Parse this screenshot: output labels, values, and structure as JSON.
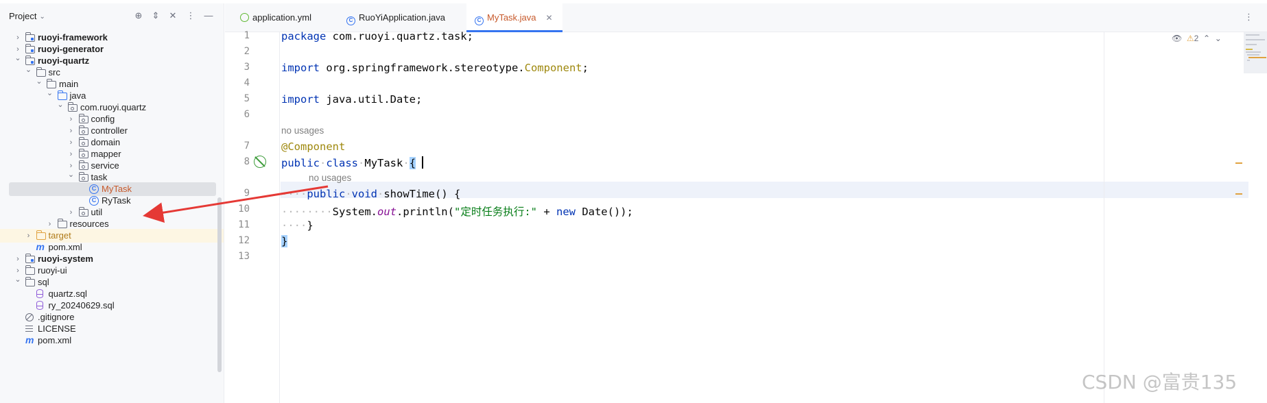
{
  "project_panel": {
    "title": "Project",
    "tree": [
      {
        "label": "ruoyi-framework",
        "depth": 0,
        "expanded": false,
        "icon": "module-folder-icon",
        "bold": true
      },
      {
        "label": "ruoyi-generator",
        "depth": 0,
        "expanded": false,
        "icon": "module-folder-icon",
        "bold": true
      },
      {
        "label": "ruoyi-quartz",
        "depth": 0,
        "expanded": true,
        "icon": "module-folder-icon",
        "bold": true
      },
      {
        "label": "src",
        "depth": 1,
        "expanded": true,
        "icon": "folder-icon"
      },
      {
        "label": "main",
        "depth": 2,
        "expanded": true,
        "icon": "folder-icon"
      },
      {
        "label": "java",
        "depth": 3,
        "expanded": true,
        "icon": "source-folder-icon"
      },
      {
        "label": "com.ruoyi.quartz",
        "depth": 4,
        "expanded": true,
        "icon": "package-icon"
      },
      {
        "label": "config",
        "depth": 5,
        "expanded": false,
        "icon": "package-icon"
      },
      {
        "label": "controller",
        "depth": 5,
        "expanded": false,
        "icon": "package-icon"
      },
      {
        "label": "domain",
        "depth": 5,
        "expanded": false,
        "icon": "package-icon"
      },
      {
        "label": "mapper",
        "depth": 5,
        "expanded": false,
        "icon": "package-icon"
      },
      {
        "label": "service",
        "depth": 5,
        "expanded": false,
        "icon": "package-icon"
      },
      {
        "label": "task",
        "depth": 5,
        "expanded": true,
        "icon": "package-icon"
      },
      {
        "label": "MyTask",
        "depth": 6,
        "icon": "class-icon",
        "selected": true
      },
      {
        "label": "RyTask",
        "depth": 6,
        "icon": "class-icon"
      },
      {
        "label": "util",
        "depth": 5,
        "expanded": false,
        "icon": "package-icon"
      },
      {
        "label": "resources",
        "depth": 3,
        "expanded": false,
        "icon": "resources-folder-icon"
      },
      {
        "label": "target",
        "depth": 1,
        "expanded": false,
        "icon": "excluded-folder-icon",
        "excluded": true
      },
      {
        "label": "pom.xml",
        "depth": 1,
        "icon": "maven-icon"
      },
      {
        "label": "ruoyi-system",
        "depth": 0,
        "expanded": false,
        "icon": "module-folder-icon",
        "bold": true
      },
      {
        "label": "ruoyi-ui",
        "depth": 0,
        "expanded": false,
        "icon": "folder-icon"
      },
      {
        "label": "sql",
        "depth": 0,
        "expanded": true,
        "icon": "folder-icon"
      },
      {
        "label": "quartz.sql",
        "depth": 1,
        "icon": "sql-file-icon"
      },
      {
        "label": "ry_20240629.sql",
        "depth": 1,
        "icon": "sql-file-icon"
      },
      {
        "label": ".gitignore",
        "depth": 0,
        "icon": "ignore-file-icon"
      },
      {
        "label": "LICENSE",
        "depth": 0,
        "icon": "text-file-icon"
      },
      {
        "label": "pom.xml",
        "depth": 0,
        "icon": "maven-icon"
      }
    ]
  },
  "tabs": [
    {
      "label": "application.yml",
      "icon": "yaml-icon",
      "active": false
    },
    {
      "label": "RuoYiApplication.java",
      "icon": "spring-boot-class-icon",
      "active": false
    },
    {
      "label": "MyTask.java",
      "icon": "class-icon",
      "active": true
    }
  ],
  "editor": {
    "line_numbers": [
      "1",
      "2",
      "3",
      "4",
      "5",
      "6",
      "7",
      "8",
      "9",
      "10",
      "11",
      "12",
      "13"
    ],
    "code": {
      "l1_kw": "package",
      "l1_rest": " com.ruoyi.quartz.task;",
      "l3_kw": "import",
      "l3_mid": " org.springframework.stereotype.",
      "l3_ann": "Component",
      "l3_end": ";",
      "l5_kw": "import",
      "l5_rest": " java.util.Date;",
      "hint_class": "no usages",
      "l7_ann": "@Component",
      "l8_kw1": "public",
      "l8_kw2": "class",
      "l8_name": "MyTask",
      "l8_brace": "{",
      "hint_method": "no usages",
      "l9_kw1": "public",
      "l9_kw2": "void",
      "l9_name": "showTime",
      "l9_rest": "() {",
      "l10_obj": "System.",
      "l10_field": "out",
      "l10_call": ".println(",
      "l10_str": "\"定时任务执行:\"",
      "l10_op": " + ",
      "l10_kw": "new",
      "l10_end": " Date());",
      "l11": "}",
      "l12": "}"
    },
    "warning_count": "2"
  },
  "watermark": "CSDN @富贵135",
  "colors": {
    "keyword": "#0033b3",
    "annotation": "#9e880d",
    "string": "#067d17",
    "static_field": "#871094",
    "active_tab_text": "#c7592b",
    "accent": "#3574f0",
    "annotation_arrow": "#e53935"
  }
}
